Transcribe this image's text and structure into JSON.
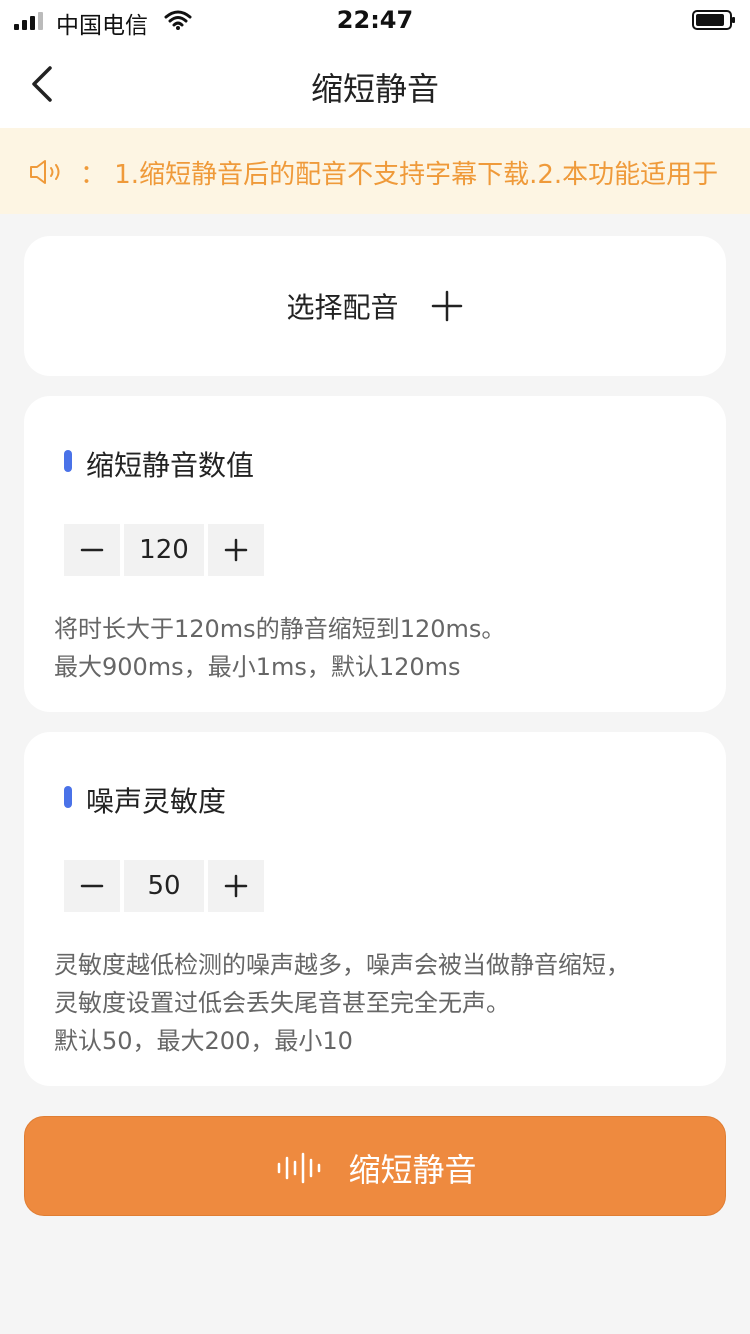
{
  "status_bar": {
    "carrier": "中国电信",
    "time": "22:47"
  },
  "nav": {
    "title": "缩短静音"
  },
  "notice": {
    "text": "：  1.缩短静音后的配音不支持字幕下载.2.本功能适用于"
  },
  "voice_select": {
    "label": "选择配音"
  },
  "silence_section": {
    "title": "缩短静音数值",
    "value": "120",
    "desc": [
      "将时长大于120ms的静音缩短到120ms。",
      "最大900ms，最小1ms，默认120ms"
    ]
  },
  "noise_section": {
    "title": "噪声灵敏度",
    "value": "50",
    "desc": [
      "灵敏度越低检测的噪声越多，噪声会被当做静音缩短，",
      "灵敏度设置过低会丢失尾音甚至完全无声。",
      "默认50，最大200，最小10"
    ]
  },
  "action": {
    "label": "缩短静音"
  },
  "icons": {
    "back": "chevron-left-icon",
    "speaker": "speaker-icon",
    "plus": "plus-icon",
    "minus": "minus-icon",
    "wave": "waveform-icon"
  },
  "colors": {
    "accent_orange": "#ee8a3f",
    "notice_text": "#ef9a3a",
    "notice_bg": "#fdf5e3",
    "section_accent": "#4a72e8"
  }
}
